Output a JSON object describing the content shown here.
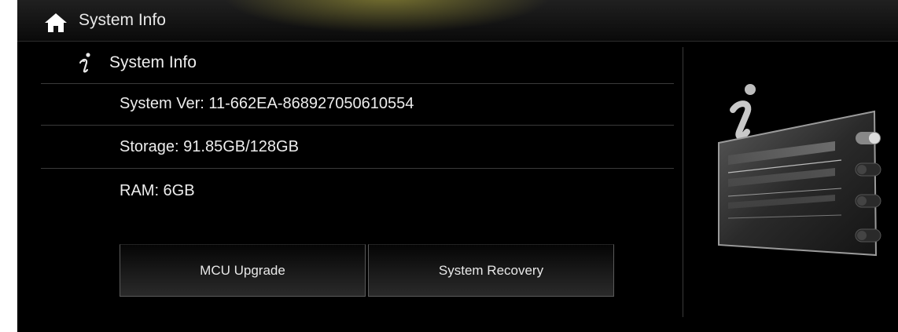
{
  "header": {
    "title": "System Info",
    "home_icon": "home-icon"
  },
  "section": {
    "title": "System Info",
    "icon": "info-icon"
  },
  "info_items": [
    {
      "label": "System Ver: 11-662EA-868927050610554"
    },
    {
      "label": "Storage: 91.85GB/128GB"
    },
    {
      "label": "RAM: 6GB"
    }
  ],
  "buttons": {
    "mcu_upgrade": "MCU Upgrade",
    "system_recovery": "System Recovery"
  },
  "colors": {
    "background": "#000000",
    "text": "#ededed",
    "header_glow": "#bcb43c",
    "divider": "#3a3a3a"
  }
}
